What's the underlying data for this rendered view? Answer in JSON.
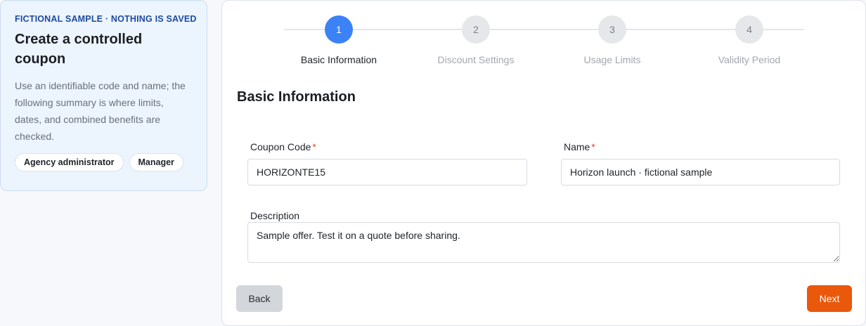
{
  "info": {
    "eyebrow": "FICTIONAL SAMPLE · NOTHING IS SAVED",
    "title": "Create a controlled coupon",
    "description": "Use an identifiable code and name; the following summary is where limits, dates, and combined benefits are checked.",
    "roles": [
      "Agency administrator",
      "Manager"
    ]
  },
  "stepper": {
    "active_step": 1,
    "steps": [
      {
        "number": "1",
        "label": "Basic Information"
      },
      {
        "number": "2",
        "label": "Discount Settings"
      },
      {
        "number": "3",
        "label": "Usage Limits"
      },
      {
        "number": "4",
        "label": "Validity Period"
      }
    ]
  },
  "form": {
    "section_title": "Basic Information",
    "coupon_code": {
      "label": "Coupon Code",
      "required_mark": "*",
      "value": "HORIZONTE15"
    },
    "name": {
      "label": "Name",
      "required_mark": "*",
      "value": "Horizon launch · fictional sample"
    },
    "description": {
      "label": "Description",
      "value": "Sample offer. Test it on a quote before sharing."
    }
  },
  "actions": {
    "back_label": "Back",
    "next_label": "Next"
  },
  "colors": {
    "accent": "#3b82f6",
    "primary_action": "#ea580c",
    "required": "#e0452f"
  }
}
